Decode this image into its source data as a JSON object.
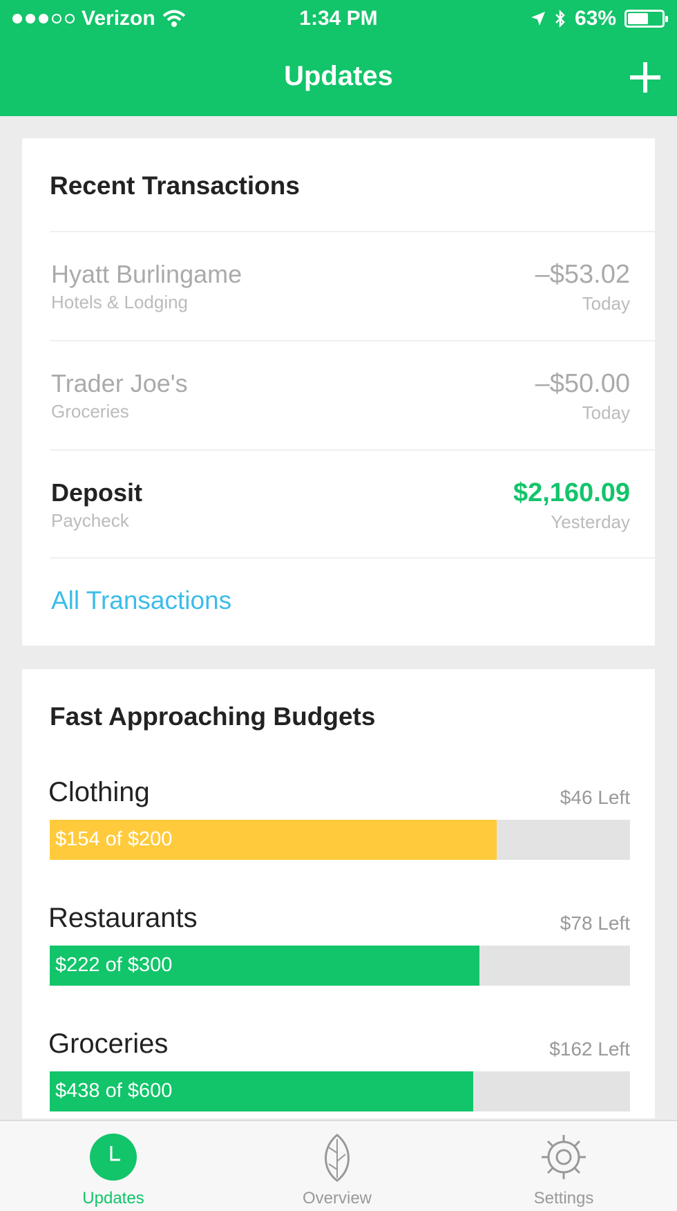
{
  "status_bar": {
    "carrier": "Verizon",
    "time": "1:34 PM",
    "battery": "63%",
    "battery_level": 0.63
  },
  "header": {
    "title": "Updates",
    "add_icon": "plus-icon"
  },
  "recent_transactions": {
    "title": "Recent Transactions",
    "items": [
      {
        "name": "Hyatt Burlingame",
        "category": "Hotels & Lodging",
        "amount": "–$53.02",
        "when": "Today"
      },
      {
        "name": "Trader Joe's",
        "category": "Groceries",
        "amount": "–$50.00",
        "when": "Today"
      },
      {
        "name": "Deposit",
        "category": "Paycheck",
        "amount": "$2,160.09",
        "when": "Yesterday"
      }
    ],
    "all_link": "All Transactions"
  },
  "budgets": {
    "title": "Fast Approaching Budgets",
    "items": [
      {
        "name": "Clothing",
        "remaining": "$46 Left",
        "progress_label": "$154 of $200",
        "spent": 154,
        "limit": 200,
        "color": "#ffcb3c"
      },
      {
        "name": "Restaurants",
        "remaining": "$78 Left",
        "progress_label": "$222 of $300",
        "spent": 222,
        "limit": 300,
        "color": "#12c46a"
      },
      {
        "name": "Groceries",
        "remaining": "$162 Left",
        "progress_label": "$438 of $600",
        "spent": 438,
        "limit": 600,
        "color": "#12c46a"
      }
    ]
  },
  "tabs": [
    {
      "label": "Updates",
      "icon": "clock-icon",
      "active": true
    },
    {
      "label": "Overview",
      "icon": "leaf-icon",
      "active": false
    },
    {
      "label": "Settings",
      "icon": "gear-icon",
      "active": false
    }
  ],
  "colors": {
    "brand": "#12c46a",
    "link": "#3bbcea",
    "warning": "#ffcb3c"
  }
}
